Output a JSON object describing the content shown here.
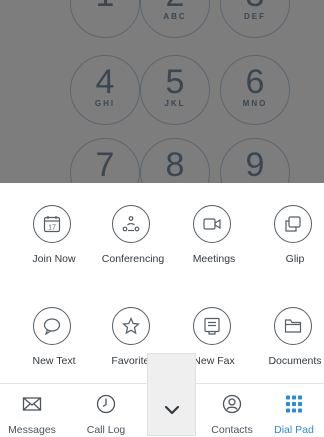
{
  "dialpad": {
    "keys": [
      {
        "digit": "1",
        "letters": ""
      },
      {
        "digit": "2",
        "letters": "ABC"
      },
      {
        "digit": "3",
        "letters": "DEF"
      },
      {
        "digit": "4",
        "letters": "GHI"
      },
      {
        "digit": "5",
        "letters": "JKL"
      },
      {
        "digit": "6",
        "letters": "MNO"
      },
      {
        "digit": "7",
        "letters": ""
      },
      {
        "digit": "8",
        "letters": ""
      },
      {
        "digit": "9",
        "letters": ""
      }
    ]
  },
  "actions": [
    {
      "label": "Join Now",
      "icon": "calendar-icon",
      "calendar_day": "17"
    },
    {
      "label": "Conferencing",
      "icon": "conference-icon"
    },
    {
      "label": "Meetings",
      "icon": "video-camera-icon"
    },
    {
      "label": "Glip",
      "icon": "glip-icon"
    },
    {
      "label": "New Text",
      "icon": "speech-bubble-icon"
    },
    {
      "label": "Favorites",
      "icon": "star-icon"
    },
    {
      "label": "New Fax",
      "icon": "fax-icon"
    },
    {
      "label": "Documents",
      "icon": "folder-icon"
    }
  ],
  "tabbar": {
    "tabs": [
      {
        "label": "Messages",
        "icon": "envelope-icon"
      },
      {
        "label": "Call Log",
        "icon": "clock-icon"
      },
      {
        "label": "Contacts",
        "icon": "contact-icon"
      },
      {
        "label": "Dial Pad",
        "icon": "dialpad-icon",
        "active": true
      }
    ],
    "collapse_icon": "chevron-down-icon"
  },
  "colors": {
    "accent": "#2b8ad9",
    "overlay": "#7d7d7d",
    "icon_stroke": "#555e66"
  }
}
